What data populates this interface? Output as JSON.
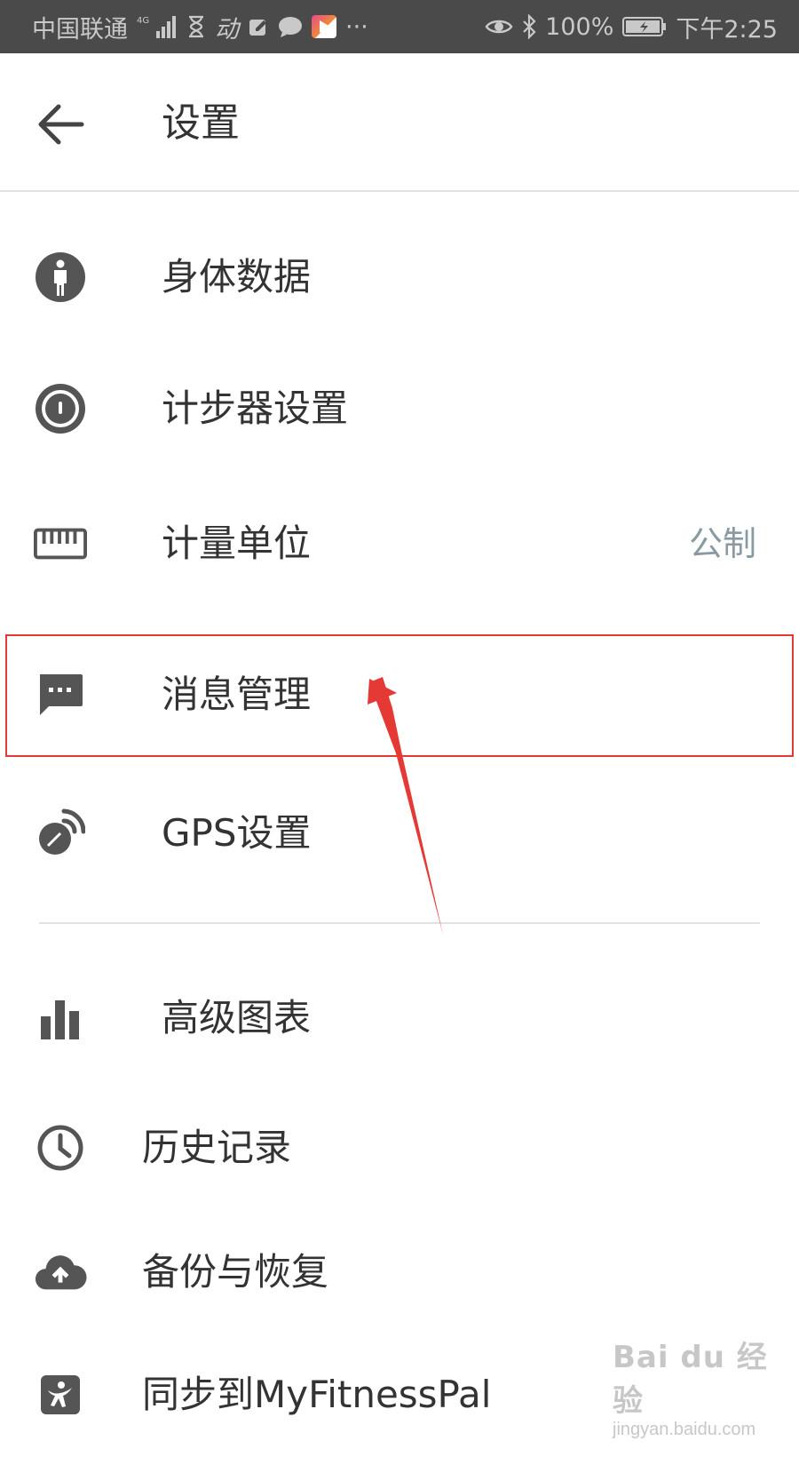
{
  "status_bar": {
    "carrier": "中国联通",
    "network": "4G",
    "app_text": "动",
    "more": "···",
    "battery": "100%",
    "time": "下午2:25"
  },
  "header": {
    "title": "设置"
  },
  "settings": {
    "items": [
      {
        "label": "身体数据",
        "icon": "person-icon"
      },
      {
        "label": "计步器设置",
        "icon": "pedometer-icon"
      },
      {
        "label": "计量单位",
        "icon": "ruler-icon",
        "value": "公制"
      },
      {
        "label": "消息管理",
        "icon": "message-icon"
      },
      {
        "label": "GPS设置",
        "icon": "gps-icon"
      }
    ],
    "advanced": [
      {
        "label": "高级图表",
        "icon": "bar-chart-icon"
      },
      {
        "label": "历史记录",
        "icon": "clock-icon"
      },
      {
        "label": "备份与恢复",
        "icon": "cloud-upload-icon"
      },
      {
        "label": "同步到MyFitnessPal",
        "icon": "myfitnesspal-icon"
      }
    ]
  },
  "watermark": {
    "logo": "Bai du 经验",
    "url": "jingyan.baidu.com"
  },
  "colors": {
    "icon": "#555555",
    "text": "#333333",
    "secondary": "#8a9aa3",
    "highlight": "#e53935",
    "status_bar": "#4a4a4a"
  }
}
